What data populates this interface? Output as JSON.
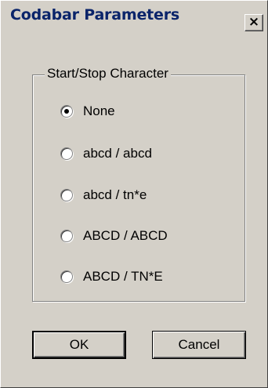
{
  "window": {
    "title": "Codabar Parameters",
    "close_glyph": "✕"
  },
  "group": {
    "label": "Start/Stop Character",
    "options": [
      {
        "label": "None",
        "selected": true
      },
      {
        "label": "abcd / abcd",
        "selected": false
      },
      {
        "label": "abcd / tn*e",
        "selected": false
      },
      {
        "label": "ABCD / ABCD",
        "selected": false
      },
      {
        "label": "ABCD / TN*E",
        "selected": false
      }
    ]
  },
  "buttons": {
    "ok_label": "OK",
    "cancel_label": "Cancel"
  },
  "colors": {
    "title_text": "#0a246a",
    "dialog_face": "#d4d0c8"
  }
}
